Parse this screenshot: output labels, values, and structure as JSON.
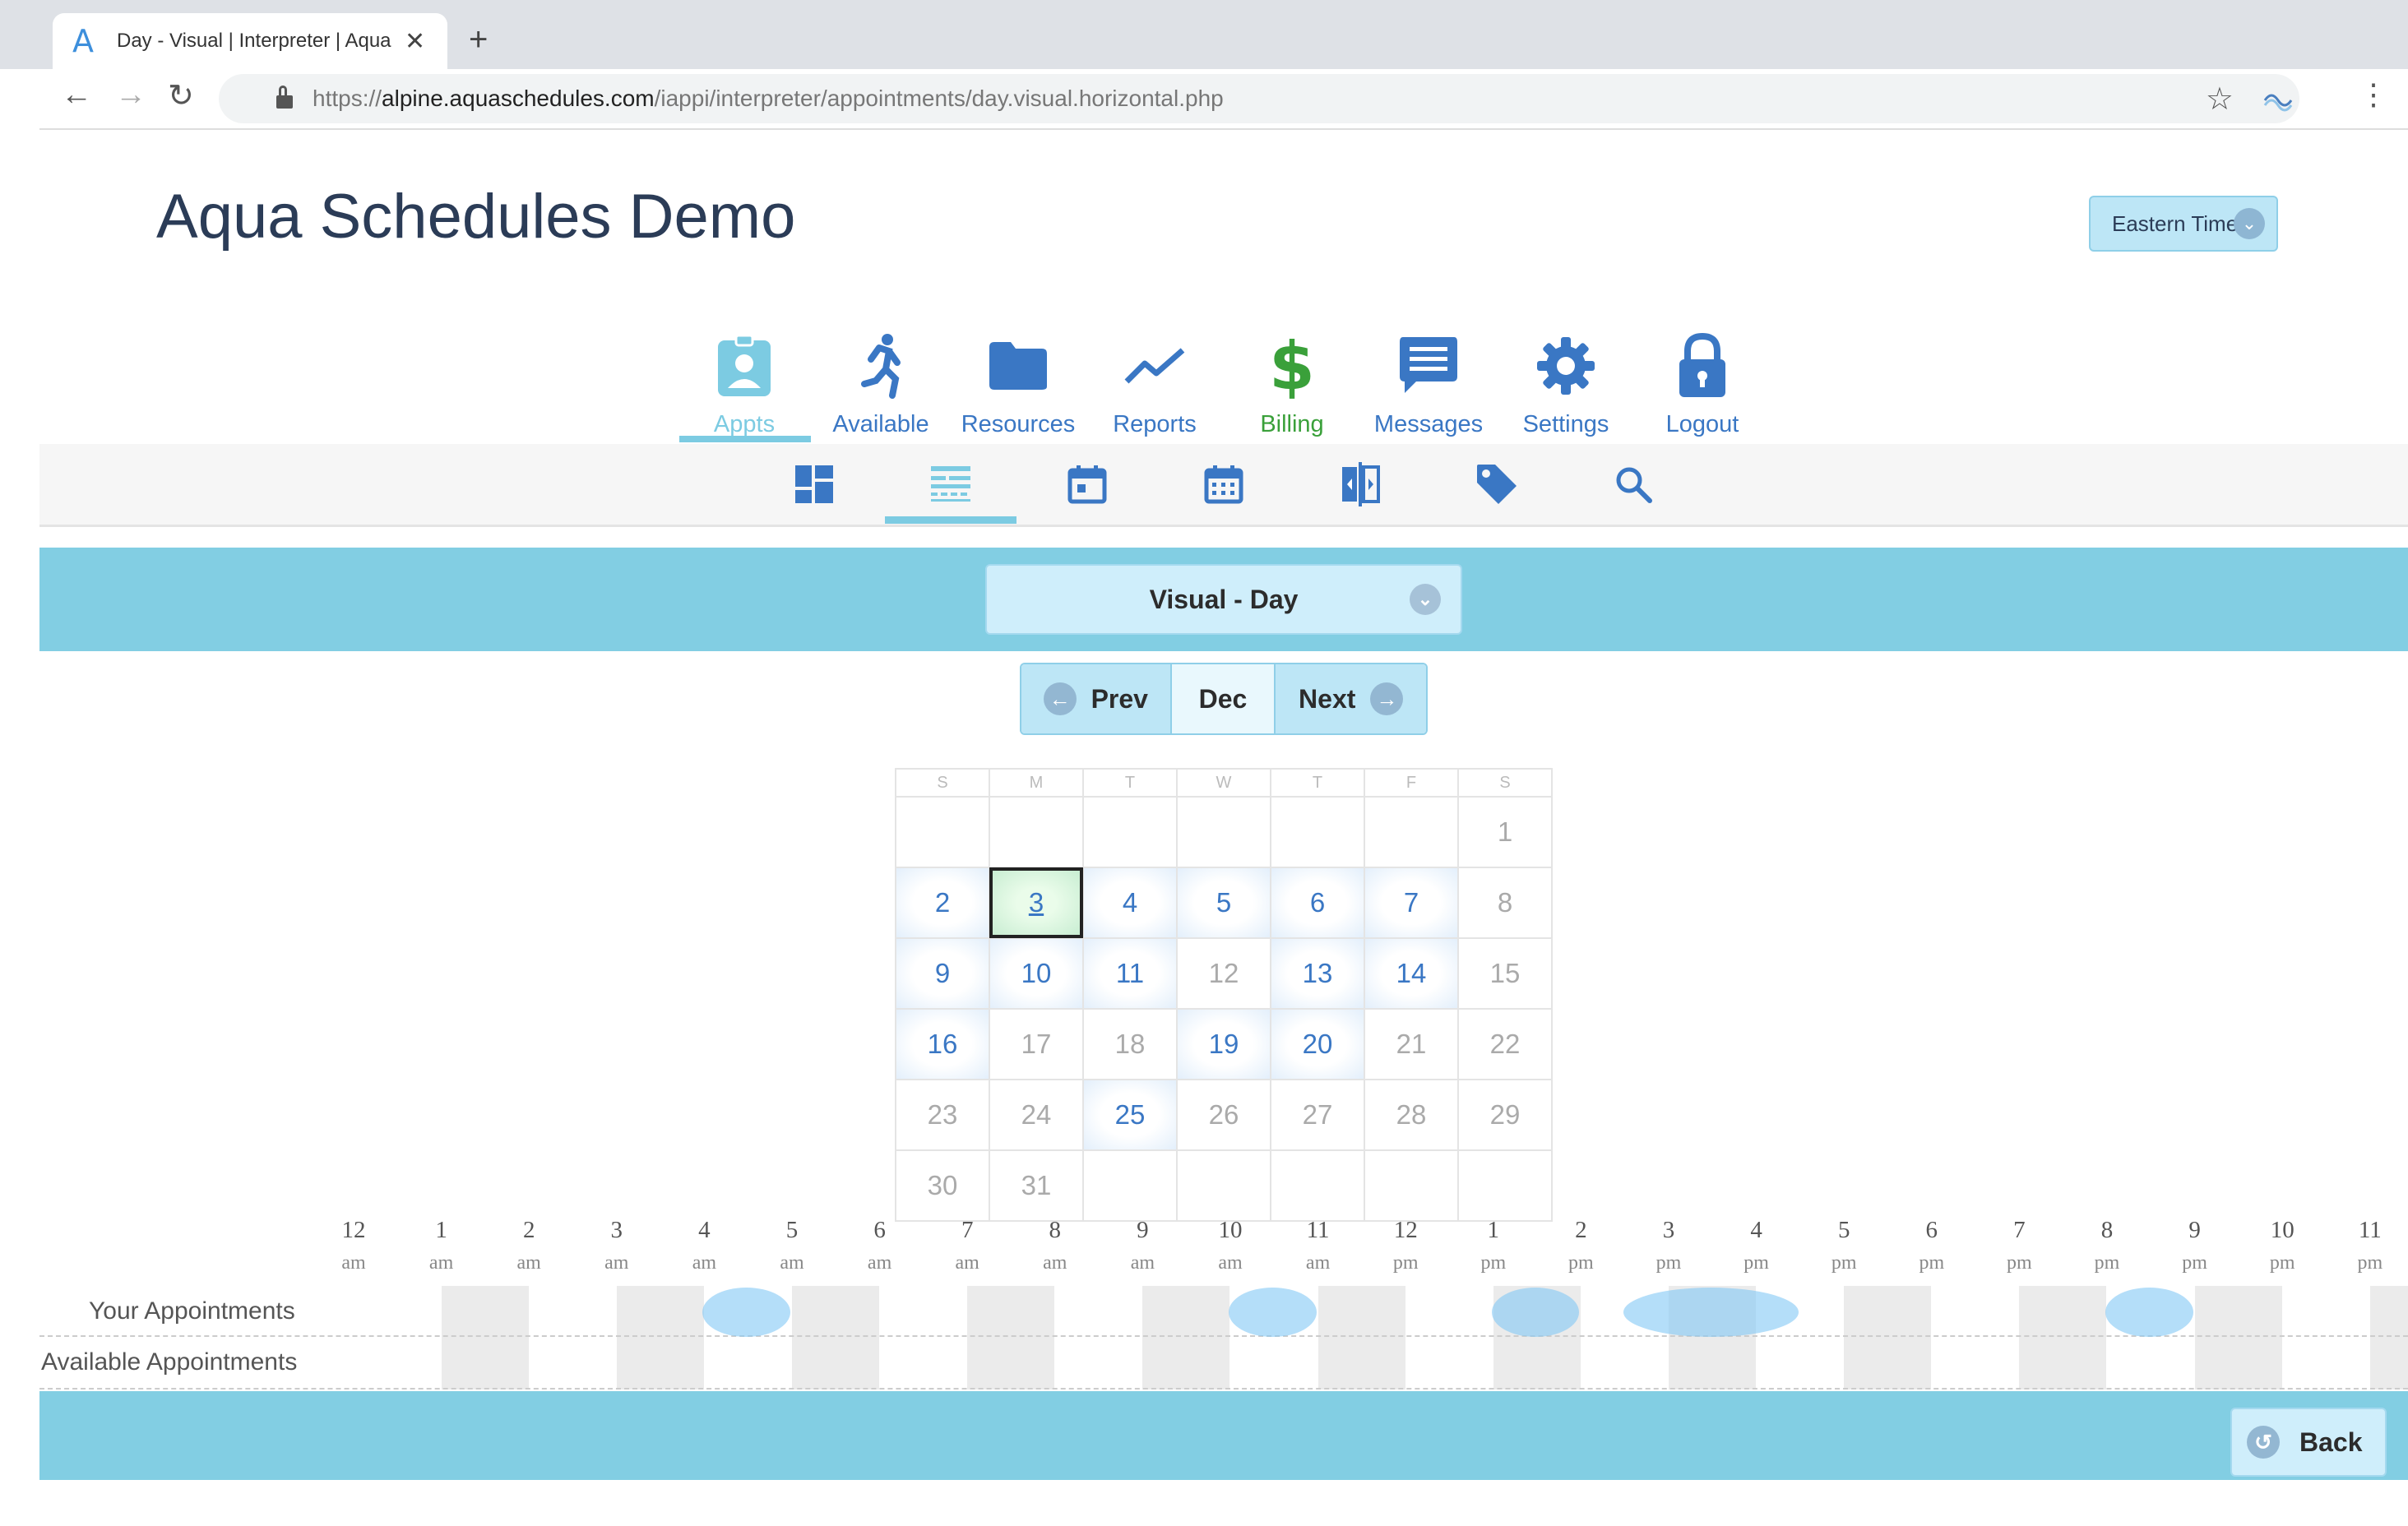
{
  "browser": {
    "tab_title": "Day - Visual | Interpreter | Aqua",
    "tab_favicon": "A",
    "url_prefix": "https://",
    "url_host": "alpine.aquaschedules.com",
    "url_path": "/iappi/interpreter/appointments/day.visual.horizontal.php",
    "extension_label": "Aqua Schedules"
  },
  "header": {
    "title": "Aqua Schedules Demo",
    "timezone_label": "Eastern Time"
  },
  "main_nav": [
    {
      "label": "Appts",
      "icon": "badge-icon",
      "active": true,
      "color": "#7ccbe2"
    },
    {
      "label": "Available",
      "icon": "running-person-icon",
      "active": false,
      "color": "#3a77c4"
    },
    {
      "label": "Resources",
      "icon": "folder-icon",
      "active": false,
      "color": "#3a77c4"
    },
    {
      "label": "Reports",
      "icon": "trend-line-icon",
      "active": false,
      "color": "#3a77c4"
    },
    {
      "label": "Billing",
      "icon": "dollar-icon",
      "active": false,
      "color": "#3aa03a"
    },
    {
      "label": "Messages",
      "icon": "message-icon",
      "active": false,
      "color": "#3a77c4"
    },
    {
      "label": "Settings",
      "icon": "gear-icon",
      "active": false,
      "color": "#3a77c4"
    },
    {
      "label": "Logout",
      "icon": "lock-icon",
      "active": false,
      "color": "#3a77c4"
    }
  ],
  "sub_nav": [
    {
      "icon": "dashboard-icon",
      "active": false
    },
    {
      "icon": "day-visual-icon",
      "active": true
    },
    {
      "icon": "calendar-day-icon",
      "active": false
    },
    {
      "icon": "calendar-month-icon",
      "active": false
    },
    {
      "icon": "split-view-icon",
      "active": false
    },
    {
      "icon": "tag-icon",
      "active": false
    },
    {
      "icon": "search-icon",
      "active": false
    }
  ],
  "view_select": {
    "label": "Visual - Day"
  },
  "pager": {
    "prev": "Prev",
    "month": "Dec",
    "next": "Next"
  },
  "calendar": {
    "weekdays": [
      "S",
      "M",
      "T",
      "W",
      "T",
      "F",
      "S"
    ],
    "weeks": [
      [
        "",
        "",
        "",
        "",
        "",
        "",
        "1"
      ],
      [
        "2",
        "3",
        "4",
        "5",
        "6",
        "7",
        "8"
      ],
      [
        "9",
        "10",
        "11",
        "12",
        "13",
        "14",
        "15"
      ],
      [
        "16",
        "17",
        "18",
        "19",
        "20",
        "21",
        "22"
      ],
      [
        "23",
        "24",
        "25",
        "26",
        "27",
        "28",
        "29"
      ],
      [
        "30",
        "31",
        "",
        "",
        "",
        "",
        ""
      ]
    ],
    "selected_day": "3",
    "available_days": [
      "2",
      "4",
      "5",
      "6",
      "7",
      "9",
      "10",
      "11",
      "13",
      "14",
      "16",
      "19",
      "20",
      "25"
    ]
  },
  "timeline": {
    "hours": [
      {
        "h": "12",
        "ap": "am"
      },
      {
        "h": "1",
        "ap": "am"
      },
      {
        "h": "2",
        "ap": "am"
      },
      {
        "h": "3",
        "ap": "am"
      },
      {
        "h": "4",
        "ap": "am"
      },
      {
        "h": "5",
        "ap": "am"
      },
      {
        "h": "6",
        "ap": "am"
      },
      {
        "h": "7",
        "ap": "am"
      },
      {
        "h": "8",
        "ap": "am"
      },
      {
        "h": "9",
        "ap": "am"
      },
      {
        "h": "10",
        "ap": "am"
      },
      {
        "h": "11",
        "ap": "am"
      },
      {
        "h": "12",
        "ap": "pm"
      },
      {
        "h": "1",
        "ap": "pm"
      },
      {
        "h": "2",
        "ap": "pm"
      },
      {
        "h": "3",
        "ap": "pm"
      },
      {
        "h": "4",
        "ap": "pm"
      },
      {
        "h": "5",
        "ap": "pm"
      },
      {
        "h": "6",
        "ap": "pm"
      },
      {
        "h": "7",
        "ap": "pm"
      },
      {
        "h": "8",
        "ap": "pm"
      },
      {
        "h": "9",
        "ap": "pm"
      },
      {
        "h": "10",
        "ap": "pm"
      },
      {
        "h": "11",
        "ap": "pm"
      }
    ],
    "row_your": "Your Appointments",
    "row_available": "Available Appointments",
    "your_appointments_hours": [
      [
        4,
        5
      ],
      [
        10,
        11
      ],
      [
        13,
        14
      ],
      [
        14.5,
        16.5
      ],
      [
        20,
        21
      ]
    ]
  },
  "footer": {
    "back_label": "Back"
  }
}
